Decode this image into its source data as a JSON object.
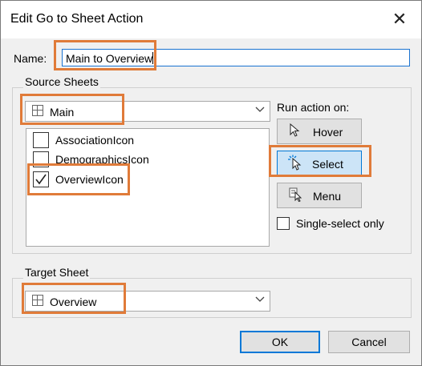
{
  "window": {
    "title": "Edit Go to Sheet Action",
    "close_glyph": "✕"
  },
  "name_field": {
    "label": "Name:",
    "value": "Main to Overview"
  },
  "source_sheets": {
    "group_label": "Source Sheets",
    "selected_sheet": "Main",
    "sheets": [
      {
        "label": "AssociationIcon",
        "checked": false
      },
      {
        "label": "DemographicsIcon",
        "checked": false
      },
      {
        "label": "OverviewIcon",
        "checked": true
      }
    ]
  },
  "run_action": {
    "label": "Run action on:",
    "hover_label": "Hover",
    "select_label": "Select",
    "menu_label": "Menu",
    "selected": "Select",
    "single_select_label": "Single-select only",
    "single_select_checked": false
  },
  "target_sheet": {
    "group_label": "Target Sheet",
    "selected_sheet": "Overview"
  },
  "footer": {
    "ok_label": "OK",
    "cancel_label": "Cancel"
  },
  "colors": {
    "highlight": "#e07b39",
    "selected_button": "#cce4f7",
    "accent": "#0078d7"
  }
}
